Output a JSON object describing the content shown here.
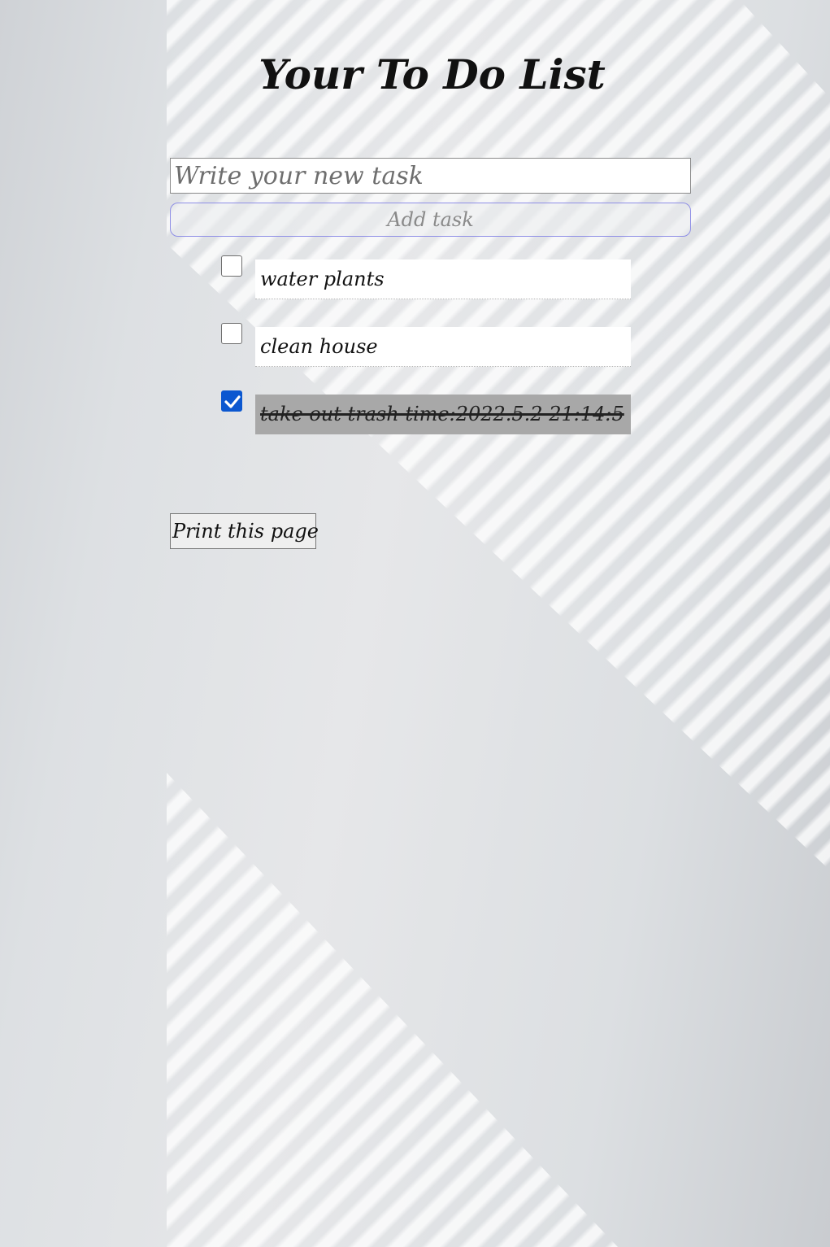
{
  "page": {
    "title": "Your To Do List"
  },
  "new_task": {
    "placeholder": "Write your new task",
    "value": ""
  },
  "add_button": {
    "label": "Add task"
  },
  "tasks": [
    {
      "text": "water plants",
      "completed": false
    },
    {
      "text": "clean house",
      "completed": false
    },
    {
      "text": "take out trash   time:2022.5.2 21:14:5",
      "completed": true
    }
  ],
  "print_button": {
    "label": "Print this page"
  },
  "colors": {
    "checkbox_checked": "#0b57d0",
    "completed_task_bg": "#a8a8a8",
    "add_button_border": "#8e8ee6"
  },
  "icons": {
    "checkmark": "check-icon"
  }
}
